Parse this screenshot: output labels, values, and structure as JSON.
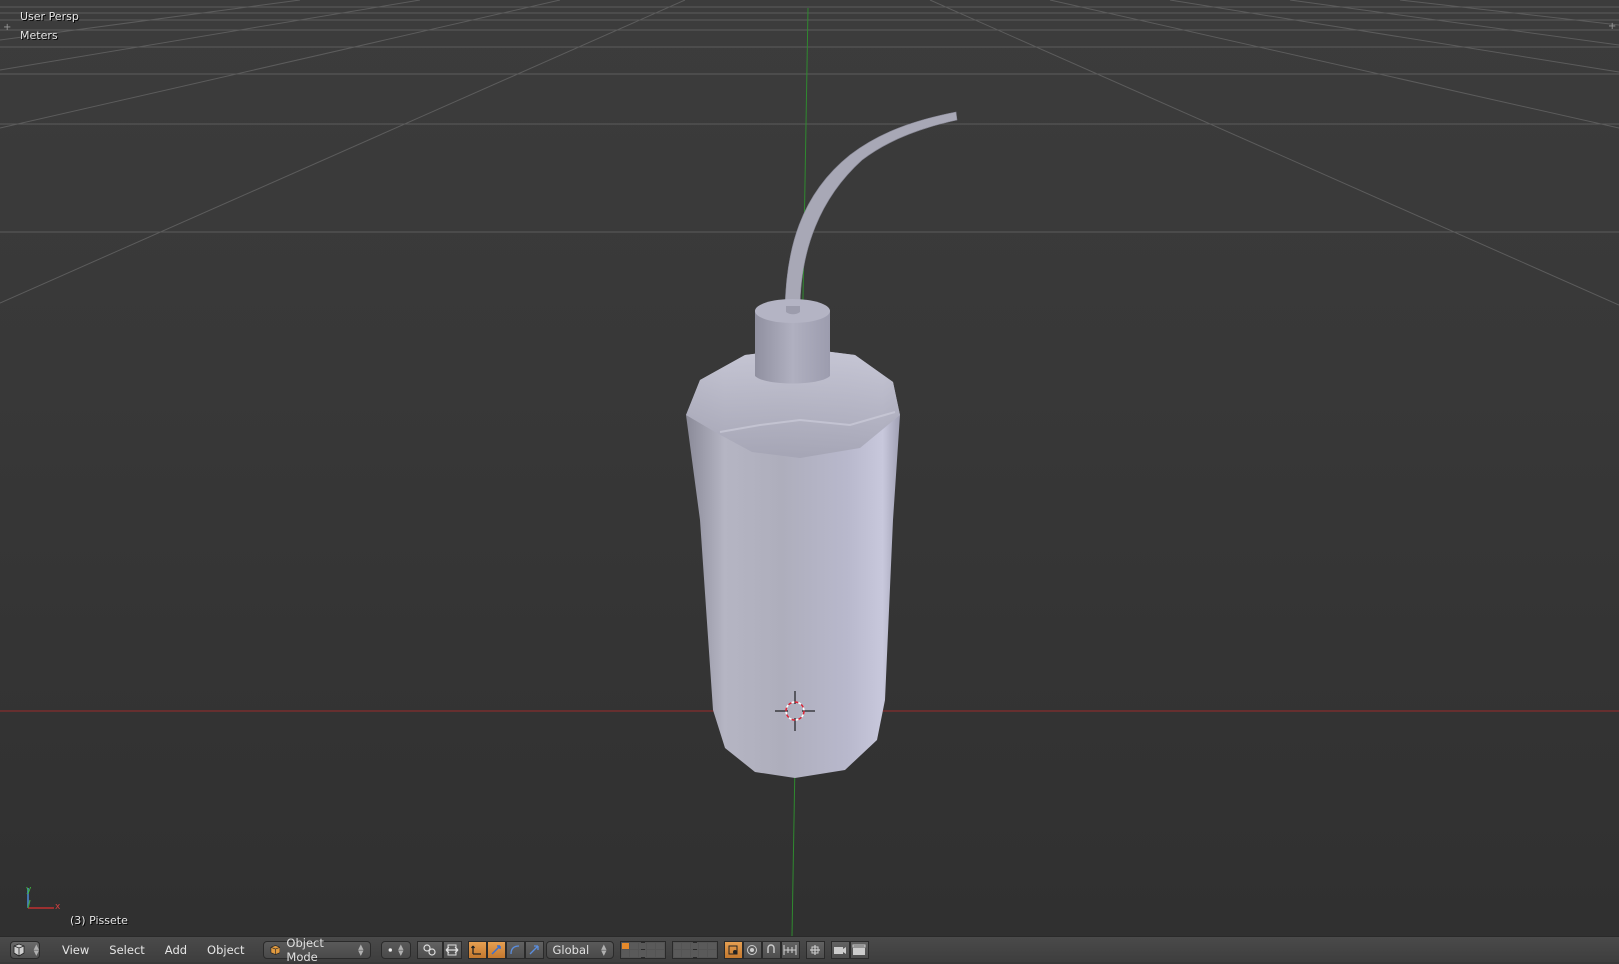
{
  "viewport": {
    "view_name": "User Persp",
    "unit_label": "Meters",
    "active_object": "(3) Pissete",
    "axis_gizmo": {
      "y_label": "y",
      "x_label": "x"
    }
  },
  "header": {
    "editor_type_icon": "3d-view-icon",
    "menus": [
      "View",
      "Select",
      "Add",
      "Object"
    ],
    "mode": "Object Mode",
    "shading_icon": "solid-sphere-icon",
    "orientation": "Global"
  },
  "colors": {
    "viewport_bg": "#393939",
    "grid": "#5a5a5a",
    "x_axis": "#b03030",
    "y_axis": "#3a9a3a",
    "header_bg": "#454545",
    "active_button": "#d98c3d",
    "model": "#b8b8c8"
  }
}
